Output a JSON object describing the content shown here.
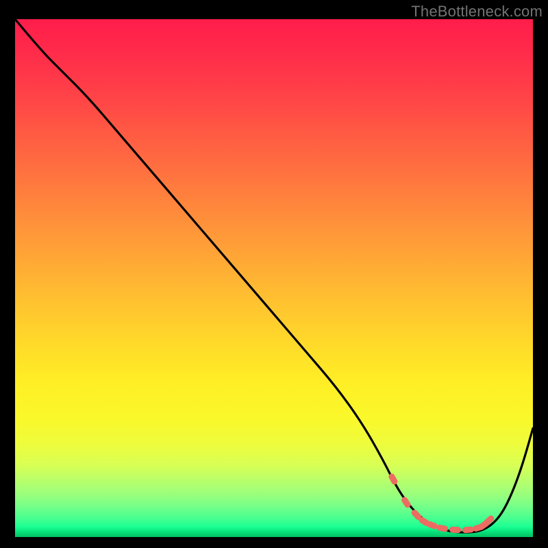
{
  "watermark": "TheBottleneck.com",
  "chart_data": {
    "type": "line",
    "title": "",
    "xlabel": "",
    "ylabel": "",
    "xlim": [
      0,
      100
    ],
    "ylim": [
      0,
      100
    ],
    "series": [
      {
        "name": "bottleneck-curve",
        "x": [
          0,
          5,
          9,
          14,
          20,
          26,
          32,
          38,
          44,
          50,
          56,
          62,
          67,
          71,
          74,
          77,
          80,
          83,
          85.5,
          88,
          90,
          92,
          94,
          96,
          98,
          100
        ],
        "y": [
          100,
          94,
          90,
          85,
          78,
          71,
          64,
          57,
          50,
          43,
          36,
          29,
          22,
          15,
          9,
          5,
          2.5,
          1.3,
          0.9,
          0.9,
          1.2,
          2.3,
          4.5,
          8.5,
          14,
          21
        ]
      }
    ],
    "markers": {
      "name": "optimal-range",
      "x": [
        73,
        75.5,
        77.5,
        79,
        80.5,
        82.5,
        85,
        87.5,
        89.5,
        90.5,
        91.5
      ],
      "y": [
        11.2,
        6.7,
        4.3,
        3.0,
        2.3,
        1.7,
        1.4,
        1.4,
        1.8,
        2.3,
        3.2
      ]
    }
  },
  "colors": {
    "curve_stroke": "#000000",
    "marker_fill": "#ec6b62",
    "frame_bg": "#000000"
  }
}
